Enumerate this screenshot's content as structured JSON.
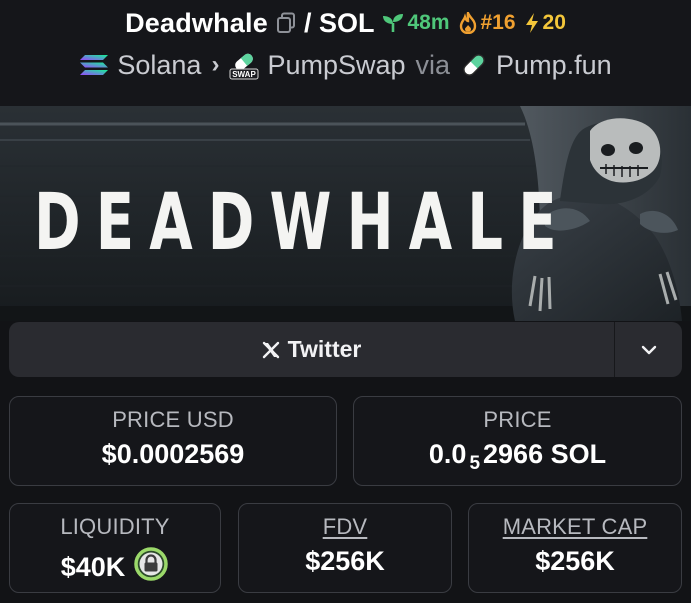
{
  "header": {
    "token_name": "Deadwhale",
    "pair_suffix": "/ SOL",
    "age": "48m",
    "rank": "#16",
    "boosts": "20",
    "chain": "Solana",
    "dex": "PumpSwap",
    "dex_icon_badge": "SWAP",
    "via_label": "via",
    "launchpad": "Pump.fun"
  },
  "banner": {
    "word": "DEADWHALE"
  },
  "social": {
    "twitter_label": "Twitter"
  },
  "stats": {
    "price_usd_label": "PRICE USD",
    "price_usd_value": "$0.0002569",
    "price_label": "PRICE",
    "price_value_prefix": "0.0",
    "price_value_subscript": "5",
    "price_value_suffix": "2966 SOL",
    "liquidity_label": "LIQUIDITY",
    "liquidity_value": "$40K",
    "fdv_label": "FDV",
    "fdv_value": "$256K",
    "market_cap_label": "MARKET CAP",
    "market_cap_value": "$256K"
  },
  "colors": {
    "background": "#121316",
    "age_green": "#4fc77a",
    "rank_orange": "#f0a030",
    "boost_yellow": "#f3c63a",
    "lock_green": "#9bd96a"
  },
  "icons": [
    "copy-icon",
    "seedling-icon",
    "flame-icon",
    "lightning-icon",
    "solana-logo",
    "pumpswap-logo",
    "pill-icon",
    "x-logo",
    "chevron-down-icon",
    "lock-icon"
  ]
}
